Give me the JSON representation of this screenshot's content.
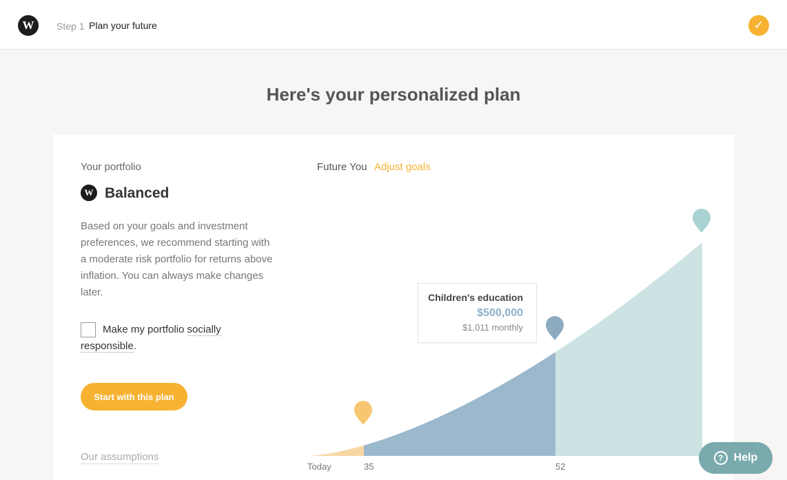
{
  "header": {
    "logo_letter": "W",
    "step_number": "Step 1",
    "step_title": "Plan your future",
    "complete_icon": "checkmark-icon",
    "complete_glyph": "✓"
  },
  "page": {
    "title": "Here's your personalized plan"
  },
  "portfolio": {
    "label": "Your portfolio",
    "logo_letter": "W",
    "name": "Balanced",
    "description": "Based on your goals and investment preferences, we recommend starting with a moderate risk portfolio for returns above inflation. You can always make changes later.",
    "socially_prefix": "Make my portfolio",
    "socially_link_1": "socially",
    "socially_link_2": "responsible",
    "socially_suffix": ".",
    "socially_checked": false,
    "start_button": "Start with this plan",
    "assumptions_link": "Our assumptions"
  },
  "future": {
    "label": "Future You",
    "adjust_link": "Adjust goals"
  },
  "tooltip": {
    "title": "Children's education",
    "amount": "$500,000",
    "monthly": "$1,011 monthly"
  },
  "chart_data": {
    "type": "area",
    "x_tick_labels": [
      "Today",
      "35",
      "52"
    ],
    "colors": {
      "today_segment": "#f7d7a3",
      "education_segment": "#9bb8cc",
      "future_segment": "#cde2e2",
      "pin_today": "#f8c571",
      "pin_education": "#8cabc1",
      "pin_future": "#a9d2d2"
    }
  },
  "help": {
    "label": "Help",
    "icon": "question-icon",
    "glyph": "?"
  }
}
